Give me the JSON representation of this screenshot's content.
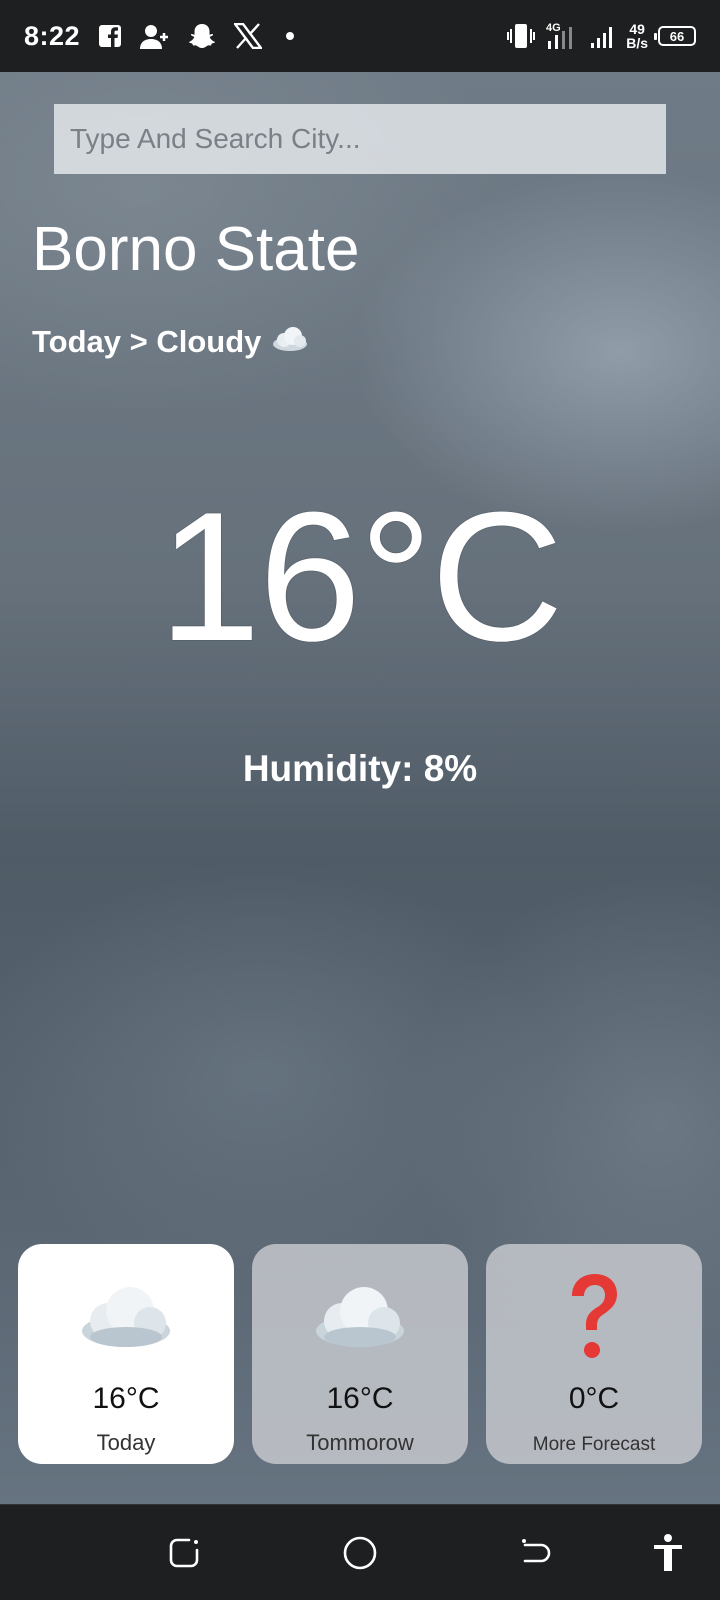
{
  "status_bar": {
    "time": "8:22",
    "network_type": "4G",
    "net_speed_value": "49",
    "net_speed_unit": "B/s",
    "battery": "66",
    "icons": [
      "facebook-icon",
      "add-contact-icon",
      "snapchat-icon",
      "x-icon",
      "vibrate-icon",
      "signal-icon",
      "battery-icon"
    ]
  },
  "search": {
    "placeholder": "Type And Search City..."
  },
  "location": {
    "city": "Borno State"
  },
  "condition": {
    "text": "Today > Cloudy",
    "icon": "cloud-icon"
  },
  "current": {
    "temperature": "16°C",
    "humidity": "Humidity: 8%"
  },
  "forecast": [
    {
      "label": "Today",
      "temp": "16°C",
      "icon": "cloud-icon",
      "active": true
    },
    {
      "label": "Tommorow",
      "temp": "16°C",
      "icon": "cloud-icon",
      "active": false
    },
    {
      "label": "More Forecast",
      "temp": "0°C",
      "icon": "question-mark-icon",
      "active": false
    }
  ],
  "nav_bar": {
    "buttons": [
      "recent-apps-icon",
      "home-icon",
      "back-icon",
      "accessibility-icon"
    ]
  },
  "colors": {
    "status_bar_bg": "#1e1f20",
    "active_card_bg": "#ffffff",
    "inactive_card_bg": "#c8cbcf",
    "question_mark": "#e53935"
  }
}
